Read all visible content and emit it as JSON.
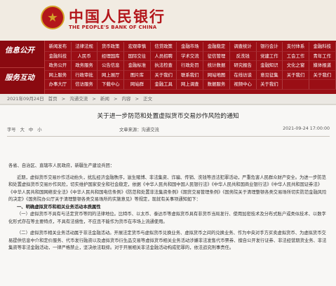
{
  "header": {
    "bank_name_cn": "中国人民银行",
    "bank_name_en": "THE PEOPLE'S BANK OF CHINA"
  },
  "nav": {
    "side_labels": [
      "信息公开",
      "服务互动"
    ],
    "rows": [
      [
        "新闻发布",
        "法律法规",
        "货币政策",
        "宏观审慎",
        "信贷政策",
        "金融市场",
        "金融稳定",
        "调查统计",
        "银行会计",
        "支付体系",
        "金融科技"
      ],
      [
        "金融科技",
        "人民币",
        "经理国库",
        "国际交往",
        "人员招聘",
        "学术交流",
        "征信管理",
        "反洗钱",
        "党建工作",
        "工会工作",
        "青年工作"
      ],
      [
        "政务公开",
        "政务服务",
        "公告信息",
        "金融标准",
        "执法检查",
        "行政处罚",
        "统计数据",
        "研究报告",
        "金融知识",
        "文化之窗",
        "媒体报道"
      ],
      [
        "网上服务",
        "行政审批",
        "网上展厅",
        "图片库",
        "关于我们",
        "联系我们",
        "网站地图",
        "在线访谈",
        "意见征集",
        "关于我们",
        "关于我们"
      ],
      [
        "办事大厅",
        "信访服务",
        "下载中心",
        "网站群",
        "金融工具",
        "网上调查",
        "数据服务",
        "视频中心",
        "关于我们",
        "",
        ""
      ]
    ]
  },
  "breadcrumb": {
    "date": "2021年09月24日",
    "items": [
      "首页",
      "沟通交流",
      "新闻",
      "内容",
      "正文"
    ]
  },
  "article": {
    "title": "关于进一步防范和处置虚拟货币交易炒作风险的通知",
    "font_label": "字号",
    "font_sizes": [
      "大",
      "中",
      "小"
    ],
    "source": "文章来源：沟通交流",
    "date": "2021-09-24 17:00:00",
    "addressee": "各省、自治区、直辖市人民政府，新疆生产建设兵团：",
    "paragraphs": [
      "近期，虚拟货币交易炒作活动抬头，扰乱经济金融秩序，滋生赌博、非法集资、诈骗、传销、洗钱等违法犯罪活动，严重危害人民群众财产安全。为进一步防范和处置虚拟货币交易炒作风险，切实维护国家安全和社会稳定，依据《中华人民共和国中国人民银行法》《中华人民共和国商业银行法》《中华人民共和国证券法》《中华人民共和国网络安全法》《中华人民共和国电信条例》《防范和处置非法集资条例》《期货交易管理条例》《国务院关于清理整顿各类交易场所切实防范金融风险的决定》《国务院办公厅关于清理整顿各类交易场所的实施意见》等规定，现就有关事项通知如下：",
      "（一）虚拟货币不具有与法定货币等同的法律地位。比特币、以太币、泰达币等虚拟货币具有非货币当局发行、使用加密技术及分布式账户或类似技术、以数字化形式存在等主要特点，不具有法偿性，不应且不能作为货币在市场上流通使用。",
      "（二）虚拟货币相关业务活动属于非法金融活动。开展法定货币与虚拟货币兑换业务、虚拟货币之间的兑换业务、作为中央对手方买卖虚拟货币、为虚拟货币交易提供信息中介和定价服务、代币发行融资以及虚拟货币衍生品交易等虚拟货币相关业务活动涉嫌非法发售代币票券、擅自公开发行证券、非法经营期货业务、非法集资等非法金融活动，一律严格禁止，坚决依法取缔。对于开展相关非法金融活动构成犯罪的，依法追究刑事责任。"
    ],
    "section_heading": "一、明确虚拟货币和相关业务活动本质属性"
  }
}
